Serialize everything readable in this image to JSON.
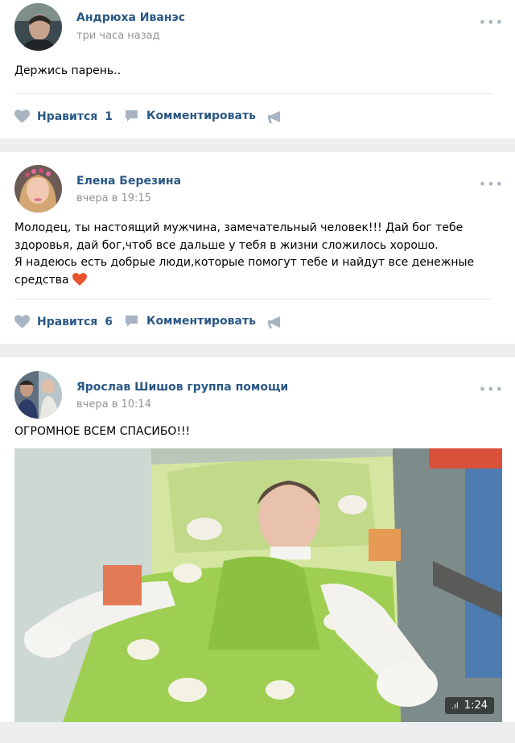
{
  "posts": [
    {
      "author": "Андрюха Иванэс",
      "time": "три часа назад",
      "text_lines": [
        "Держись парень.."
      ],
      "like_label": "Нравится",
      "like_count": "1",
      "comment_label": "Комментировать"
    },
    {
      "author": "Елена Березина",
      "time": "вчера в 19:15",
      "text_lines": [
        "Молодец, ты настоящий мужчина, замечательный человек!!! Дай бог тебе",
        "здоровья, дай бог,чтоб все дальше у тебя в жизни сложилось хорошо.",
        "Я надеюсь есть добрые люди,которые помогут тебе и найдут все денежные",
        "средства"
      ],
      "like_label": "Нравится",
      "like_count": "6",
      "comment_label": "Комментировать"
    },
    {
      "author": "Ярослав Шишов группа помощи",
      "time": "вчера в 10:14",
      "text_lines": [
        "ОГРОМНОЕ ВСЕМ СПАСИБО!!!"
      ],
      "video_duration": "1:24"
    }
  ],
  "more_label": "•••",
  "badge_icon": ".ıl",
  "colors": {
    "link": "#2a5885",
    "muted": "#939393",
    "icon": "#a8b4c2",
    "heart_emoji": "#e8542d",
    "background": "#edeef0"
  },
  "icons": [
    "heart-icon",
    "comment-icon",
    "share-icon",
    "more-icon",
    "heart-emoji-icon",
    "video-stats-icon"
  ]
}
